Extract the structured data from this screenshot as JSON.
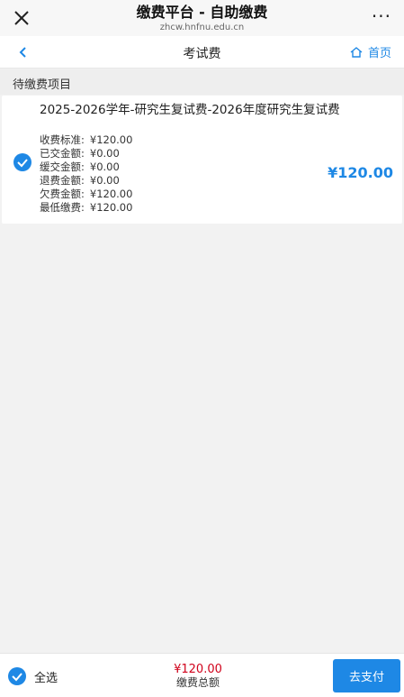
{
  "window": {
    "title": "缴费平台 - 自助缴费",
    "domain": "zhcw.hnfnu.edu.cn",
    "more_label": "···"
  },
  "nav": {
    "title": "考试费",
    "home_label": "首页"
  },
  "section": {
    "header": "待缴费项目"
  },
  "item": {
    "selected": true,
    "name": "2025-2026学年-研究生复试费-2026年度研究生复试费",
    "details": [
      {
        "label": "收费标准:",
        "value": "¥120.00"
      },
      {
        "label": "已交金额:",
        "value": "¥0.00"
      },
      {
        "label": "缓交金额:",
        "value": "¥0.00"
      },
      {
        "label": "退费金额:",
        "value": "¥0.00"
      },
      {
        "label": "欠费金额:",
        "value": "¥120.00"
      },
      {
        "label": "最低缴费:",
        "value": "¥120.00"
      }
    ],
    "amount": "¥120.00"
  },
  "footer": {
    "select_all_label": "全选",
    "total_amount": "¥120.00",
    "total_label": "缴费总额",
    "pay_button_label": "去支付"
  },
  "colors": {
    "accent": "#1e88e5",
    "total_red": "#d0021b"
  }
}
